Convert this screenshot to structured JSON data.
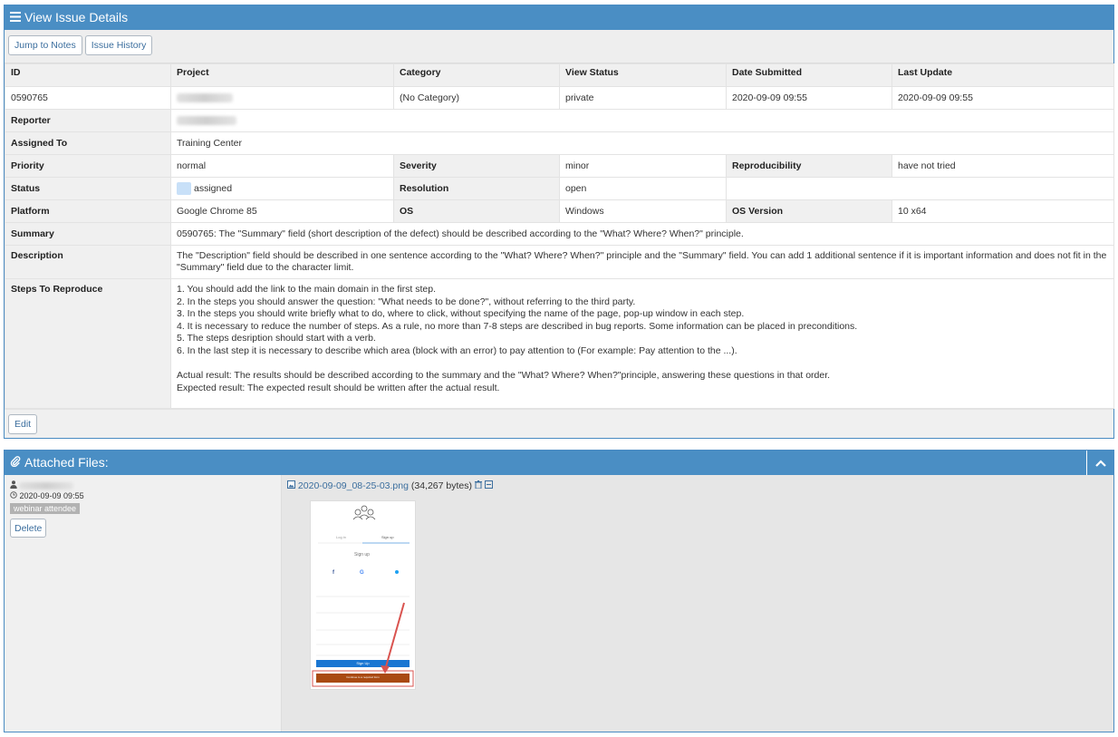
{
  "issue_panel": {
    "title": "View Issue Details",
    "toolbar": {
      "jump_to_notes": "Jump to Notes",
      "issue_history": "Issue History"
    },
    "headers": [
      "ID",
      "Project",
      "Category",
      "View Status",
      "Date Submitted",
      "Last Update"
    ],
    "row_values": {
      "id": "0590765",
      "category": "(No Category)",
      "view_status": "private",
      "date_submitted": "2020-09-09 09:55",
      "last_update": "2020-09-09 09:55"
    },
    "labels": {
      "reporter": "Reporter",
      "assigned_to": "Assigned To",
      "priority": "Priority",
      "severity": "Severity",
      "reproducibility": "Reproducibility",
      "status": "Status",
      "resolution": "Resolution",
      "platform": "Platform",
      "os": "OS",
      "os_version": "OS Version",
      "summary": "Summary",
      "description": "Description",
      "steps": "Steps To Reproduce"
    },
    "values": {
      "assigned_to": "Training Center",
      "priority": "normal",
      "severity": "minor",
      "reproducibility": "have not tried",
      "status": "assigned",
      "resolution": "open",
      "platform": "Google Chrome 85",
      "os": "Windows",
      "os_version": "10 x64",
      "summary": "0590765: The \"Summary\" field (short description of the defect) should be described according to the \"What? Where? When?\" principle.",
      "description": "The \"Description\" field should be described in one sentence according to the \"What? Where? When?\" principle and the \"Summary\" field. You can add 1 additional sentence if it is important information and does not fit in the \"Summary\" field due to the character limit."
    },
    "steps": [
      "1. You should add the link to the main domain in the first step.",
      "2. In the steps you should answer the question: \"What needs to be done?\", without referring to the third party.",
      "3. In the steps you should write briefly what to do, where to click, without specifying the name of the page, pop-up window in each step.",
      "4. It is necessary to reduce the number of steps. As a rule, no more than 7-8 steps are described in bug reports. Some information can be placed in preconditions.",
      "5. The steps desription should start with a verb.",
      "6. In the last step it is necessary to describe which area (block with an error) to pay attention to (For example: Pay attention to the ...)."
    ],
    "actual_result": "Actual result: The results should be described according to the summary and the \"What? Where? When?\"principle, answering these questions in that order.",
    "expected_result": "Expected result: The expected result should be written after the actual result.",
    "edit_label": "Edit"
  },
  "attach_panel": {
    "title": "Attached Files:",
    "uploader_date": "2020-09-09 09:55",
    "uploader_tag": "webinar attendee",
    "delete_label": "Delete",
    "file_name": "2020-09-09_08-25-03.png",
    "file_size": "(34,267 bytes)"
  },
  "thumbnail": {
    "tab_login": "Log in",
    "tab_signup": "Sign up",
    "heading": "Sign up",
    "signup_button": "Sign Up",
    "highlight_bar_text": "Continue to a required form"
  },
  "colors": {
    "header_blue": "#4a8ec4",
    "link_blue": "#3b6e9e",
    "highlight": "#c0392b"
  },
  "icons": [
    "menu-icon",
    "paperclip-icon",
    "chevron-up-icon",
    "user-icon",
    "clock-icon",
    "image-file-icon",
    "trash-icon",
    "collapse-icon"
  ]
}
